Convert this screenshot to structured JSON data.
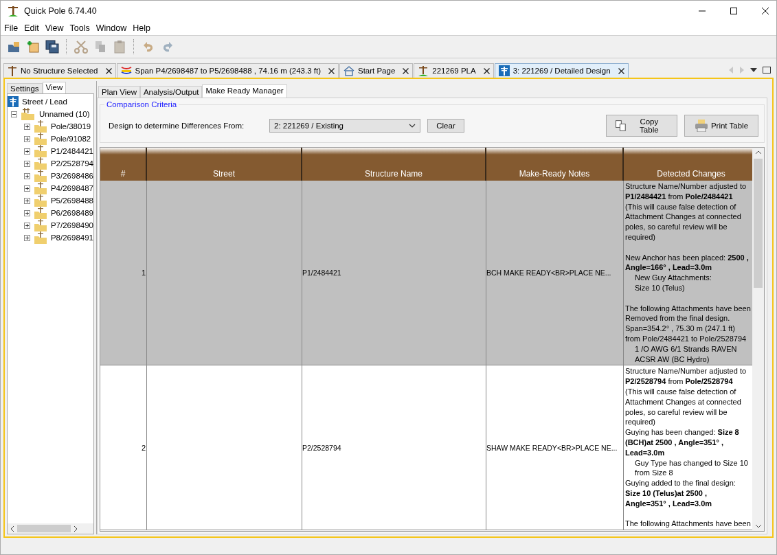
{
  "window": {
    "title": "Quick Pole 6.74.40"
  },
  "menu": [
    "File",
    "Edit",
    "View",
    "Tools",
    "Window",
    "Help"
  ],
  "doc_tabs": [
    {
      "label": "No Structure Selected",
      "kind": "pole",
      "selected": false
    },
    {
      "label": "Span P4/2698487 to P5/2698488 , 74.16 m (243.3 ft)",
      "kind": "span",
      "selected": false
    },
    {
      "label": "Start Page",
      "kind": "home",
      "selected": false
    },
    {
      "label": "221269 PLA",
      "kind": "pla",
      "selected": false
    },
    {
      "label": "3: 221269 / Detailed Design",
      "kind": "design",
      "selected": true
    }
  ],
  "side_tabs": [
    {
      "label": "Settings",
      "selected": false
    },
    {
      "label": "View",
      "selected": true
    }
  ],
  "tree": [
    {
      "label": "Street / Lead",
      "kind": "root",
      "expanded": true,
      "children": [
        {
          "label": "Unnamed (10)",
          "kind": "group",
          "expanded": true,
          "children": [
            {
              "label": "Pole/38019",
              "kind": "pole",
              "expanded": false
            },
            {
              "label": "Pole/91082",
              "kind": "pole",
              "expanded": false
            },
            {
              "label": "P1/2484421",
              "kind": "pole",
              "expanded": false
            },
            {
              "label": "P2/2528794",
              "kind": "pole",
              "expanded": false
            },
            {
              "label": "P3/2698486",
              "kind": "pole",
              "expanded": false
            },
            {
              "label": "P4/2698487",
              "kind": "pole",
              "expanded": false
            },
            {
              "label": "P5/2698488",
              "kind": "pole",
              "expanded": false
            },
            {
              "label": "P6/2698489",
              "kind": "pole",
              "expanded": false
            },
            {
              "label": "P7/2698490",
              "kind": "pole",
              "expanded": false
            },
            {
              "label": "P8/2698491",
              "kind": "pole",
              "expanded": false
            }
          ]
        }
      ]
    }
  ],
  "view_tabs": [
    {
      "label": "Plan View",
      "selected": false
    },
    {
      "label": "Analysis/Output",
      "selected": false
    },
    {
      "label": "Make Ready Manager",
      "selected": true
    }
  ],
  "comparison": {
    "title": "Comparison Criteria",
    "label": "Design to determine Differences From:",
    "value": "2: 221269 / Existing",
    "clear_button": "Clear",
    "copy_button": "Copy Table",
    "print_button": "Print Table"
  },
  "table": {
    "columns": [
      "#",
      "Street",
      "Structure Name",
      "Make-Ready Notes",
      "Detected Changes"
    ],
    "rows": [
      {
        "number": "1",
        "structure": "P1/2484421",
        "notes": "BCH MAKE READY<BR>PLACE NE...",
        "selected": true,
        "changes": [
          [
            {
              "text": "Structure Name/Number adjusted to",
              "indent": false
            },
            {
              "text": "**P1/2484421** from **Pole/2484421**",
              "indent": false
            },
            {
              "text": "(This will cause false detection of",
              "indent": false
            },
            {
              "text": "Attachment Changes at connected",
              "indent": false
            },
            {
              "text": "poles, so careful review will be",
              "indent": false
            },
            {
              "text": "required)",
              "indent": false
            }
          ],
          [
            {
              "text": "New Anchor has been placed: **2500 ,**",
              "indent": false
            },
            {
              "text": "**Angle=166° , Lead=3.0m**",
              "indent": false
            },
            {
              "text": "New Guy Attachments:",
              "indent": true
            },
            {
              "text": "Size 10 (Telus)",
              "indent": true
            }
          ],
          [
            {
              "text": "The following Attachments have been",
              "indent": false
            },
            {
              "text": "Removed from the final design.",
              "indent": false
            },
            {
              "text": "Span=354.2° , 75.30 m (247.1 ft)",
              "indent": false
            },
            {
              "text": "from Pole/2484421 to Pole/2528794",
              "indent": false
            },
            {
              "text": "1 /O AWG 6/1 Strands RAVEN",
              "indent": true
            },
            {
              "text": "ACSR AW (BC Hydro)",
              "indent": true
            }
          ]
        ]
      },
      {
        "number": "2",
        "structure": "P2/2528794",
        "notes": "SHAW MAKE READY<BR>PLACE NE...",
        "selected": false,
        "changes": [
          [
            {
              "text": "Structure Name/Number adjusted to",
              "indent": false
            },
            {
              "text": "**P2/2528794** from **Pole/2528794**",
              "indent": false
            },
            {
              "text": "(This will cause false detection of",
              "indent": false
            },
            {
              "text": "Attachment Changes at connected",
              "indent": false
            },
            {
              "text": "poles, so careful review will be",
              "indent": false
            },
            {
              "text": "required)",
              "indent": false
            },
            {
              "text": "Guying has been changed: **Size 8**",
              "indent": false
            },
            {
              "text": "**(BCH)at 2500 , Angle=351° ,**",
              "indent": false
            },
            {
              "text": "**Lead=3.0m**",
              "indent": false
            },
            {
              "text": "Guy Type has changed to Size 10",
              "indent": true
            },
            {
              "text": "from Size 8",
              "indent": true
            },
            {
              "text": "Guying added to the final design:",
              "indent": false
            },
            {
              "text": "**Size 10 (Telus)at 2500 ,**",
              "indent": false
            },
            {
              "text": "**Angle=351° , Lead=3.0m**",
              "indent": false
            }
          ],
          [
            {
              "text": "The following Attachments have been",
              "indent": false
            }
          ]
        ]
      }
    ]
  }
}
